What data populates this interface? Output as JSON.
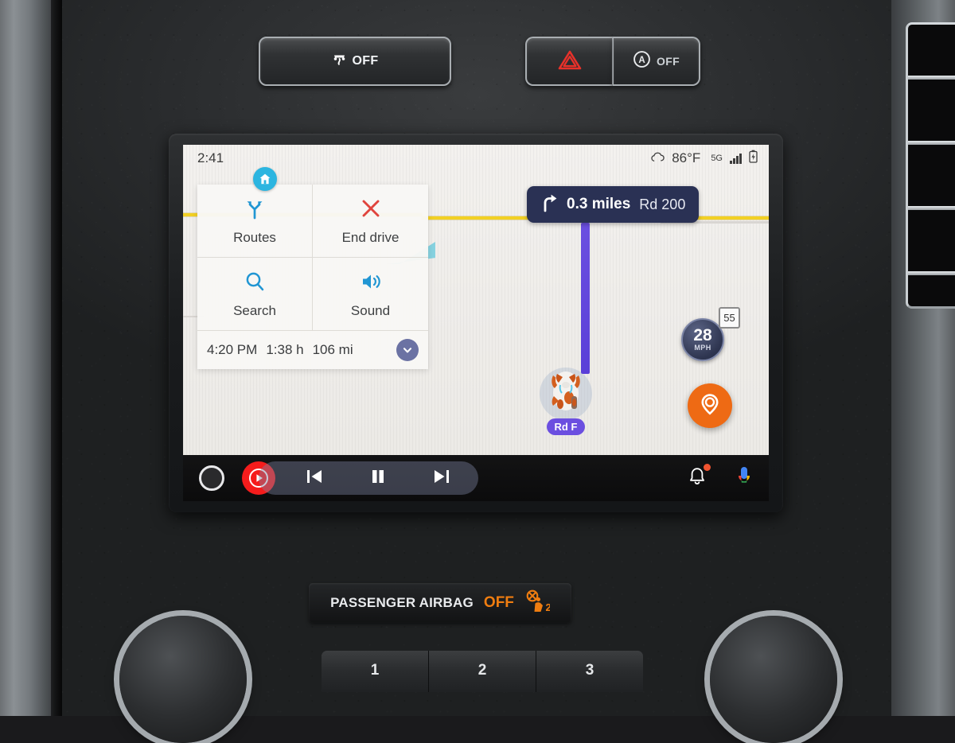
{
  "vehicle_controls": {
    "traction_control": {
      "label": "OFF",
      "icon": "traction-control-icon"
    },
    "hazard": {
      "icon": "hazard-triangle-icon"
    },
    "auto_start_stop": {
      "label": "OFF",
      "icon": "auto-start-stop-icon"
    }
  },
  "screen": {
    "status_bar": {
      "clock": "2:41",
      "weather_icon": "cloud-icon",
      "temperature": "86°F",
      "network": "5G",
      "battery_icon": "battery-icon"
    },
    "panel": {
      "home_icon": "home-icon",
      "actions": [
        {
          "label": "Routes",
          "icon": "routes-fork-icon"
        },
        {
          "label": "End drive",
          "icon": "close-x-icon"
        },
        {
          "label": "Search",
          "icon": "search-icon"
        },
        {
          "label": "Sound",
          "icon": "speaker-icon"
        }
      ],
      "eta": {
        "arrival_time": "4:20 PM",
        "duration": "1:38 h",
        "distance": "106 mi",
        "expand_icon": "chevron-down-icon"
      }
    },
    "navigation": {
      "maneuver_icon": "turn-right-icon",
      "distance": "0.3 miles",
      "road": "Rd 200"
    },
    "speedometer": {
      "speed": "28",
      "unit": "MPH",
      "speed_limit": "55"
    },
    "recenter_icon": "location-pin-icon",
    "vehicle_marker": {
      "icon": "dog-avatar-icon",
      "road_label": "Rd F"
    },
    "nav_bar": {
      "home_icon": "home-circle-icon",
      "media_app_icon": "youtube-music-icon",
      "previous_icon": "previous-track-icon",
      "pause_icon": "pause-icon",
      "next_icon": "next-track-icon",
      "notifications_icon": "bell-icon",
      "assistant_icon": "microphone-icon"
    }
  },
  "console": {
    "airbag": {
      "text": "PASSENGER AIRBAG",
      "status": "OFF",
      "icon": "airbag-off-icon"
    },
    "presets": [
      "1",
      "2",
      "3"
    ]
  },
  "colors": {
    "accent_blue": "#2196d3",
    "route_purple": "#6b4fe0",
    "nav_banner": "#2a3154",
    "recenter_orange": "#ee6a14",
    "warn_orange": "#ef7d10",
    "media_red": "#f51c1c",
    "road_yellow": "#f2d024",
    "water_cyan": "#87d2e0"
  }
}
